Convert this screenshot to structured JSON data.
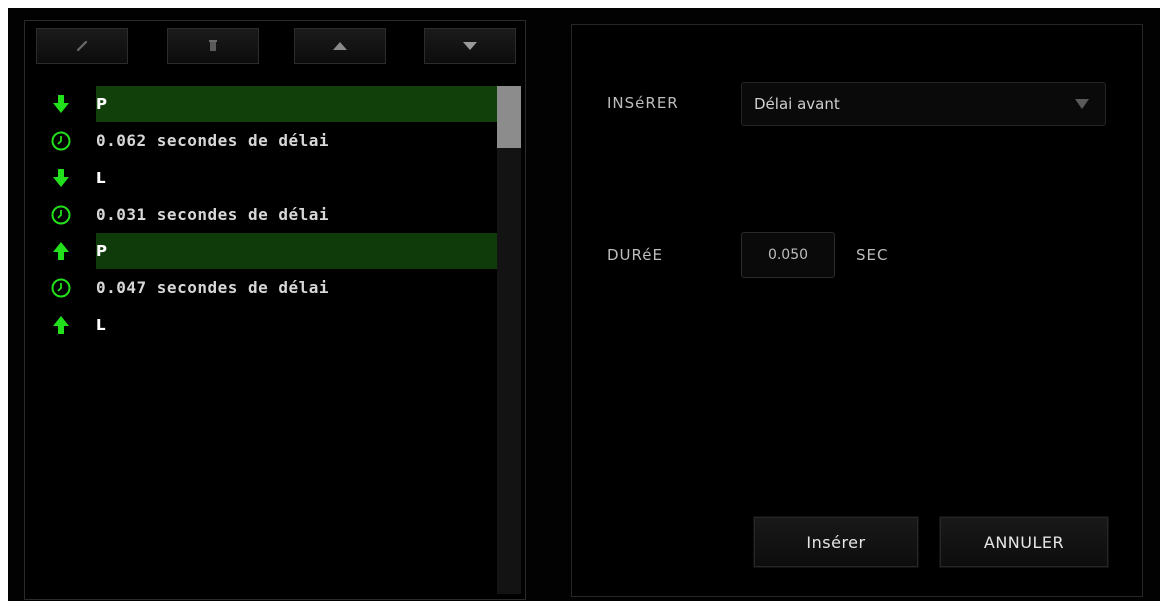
{
  "macro_list": {
    "toolbar": {
      "edit_icon": "pencil-icon",
      "delete_icon": "trash-icon",
      "move_up_icon": "arrow-up-icon",
      "move_down_icon": "arrow-down-icon"
    },
    "items": [
      {
        "type": "key-down",
        "icon": "arrow-down-icon",
        "text": "P",
        "selected": true
      },
      {
        "type": "delay",
        "icon": "clock-icon",
        "text": "0.062 secondes de délai",
        "selected": false
      },
      {
        "type": "key-down",
        "icon": "arrow-down-icon",
        "text": "L",
        "selected": false
      },
      {
        "type": "delay",
        "icon": "clock-icon",
        "text": "0.031 secondes de délai",
        "selected": false
      },
      {
        "type": "key-up",
        "icon": "arrow-up-icon",
        "text": "P",
        "selected": true
      },
      {
        "type": "delay",
        "icon": "clock-icon",
        "text": "0.047 secondes de délai",
        "selected": false
      },
      {
        "type": "key-up",
        "icon": "arrow-up-icon",
        "text": "L",
        "selected": false
      }
    ]
  },
  "insert_panel": {
    "insert_label": "INSéRER",
    "insert_selected": "Délai avant",
    "duration_label": "DURéE",
    "duration_value": "0.050",
    "duration_unit": "SEC",
    "insert_button": "Insérer",
    "cancel_button": "ANNULER"
  },
  "colors": {
    "accent_green": "#22e01c",
    "selected_row": "#0f3a0a",
    "background": "#000000"
  }
}
